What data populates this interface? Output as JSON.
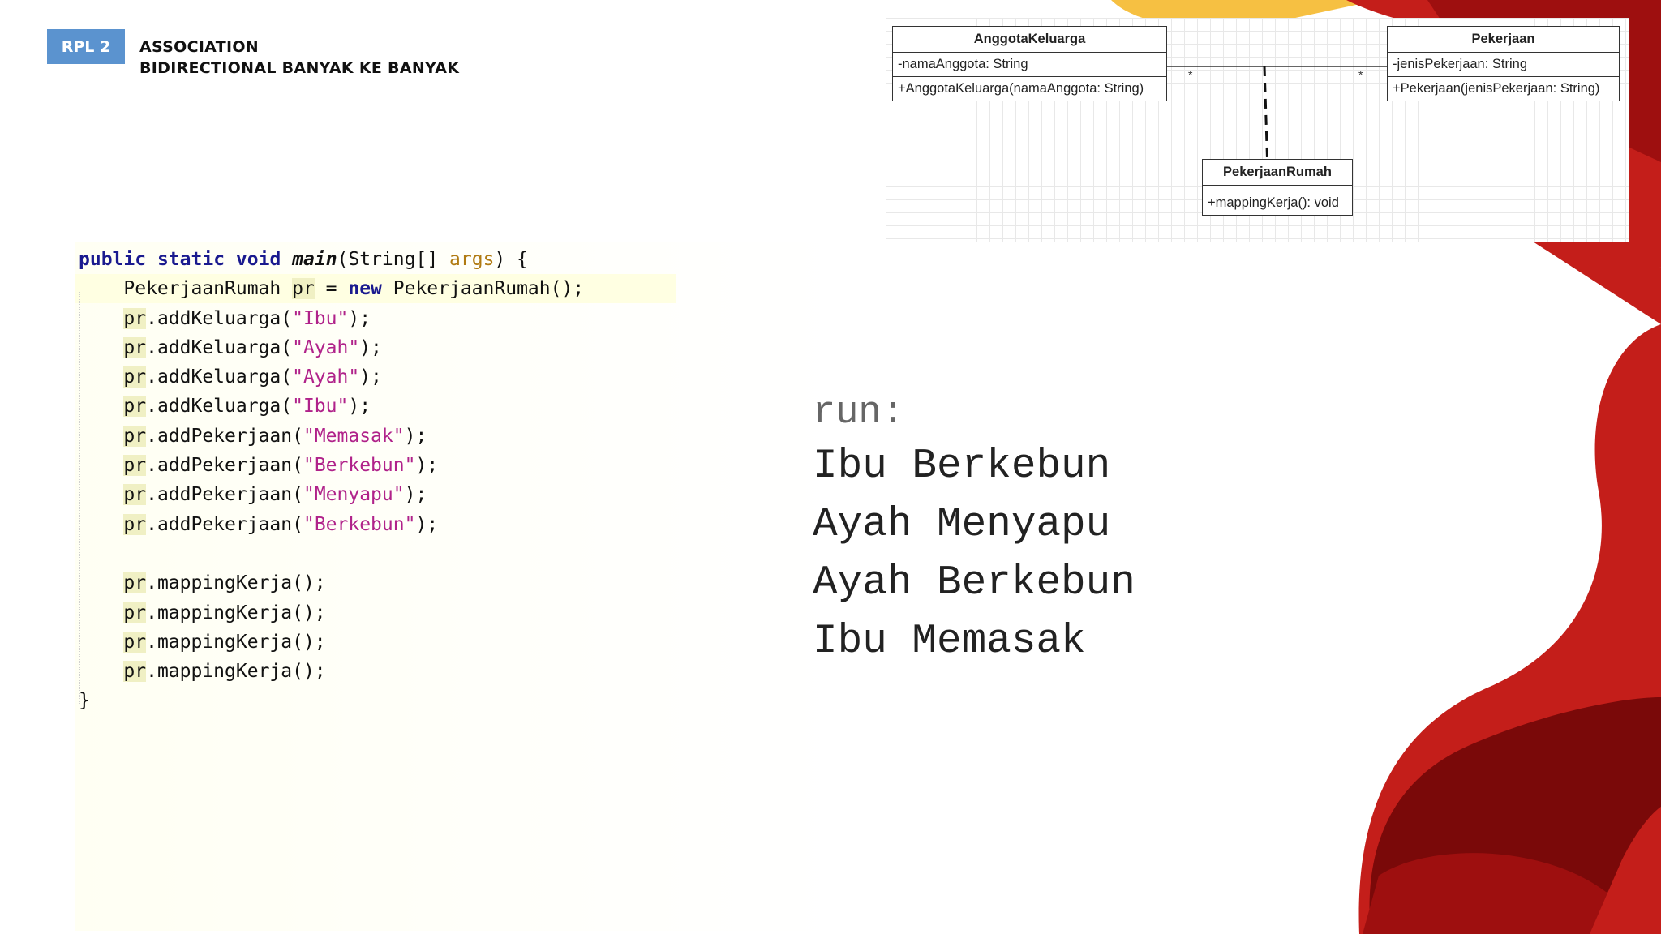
{
  "badge": {
    "label": "RPL 2"
  },
  "header": {
    "title_line1": "ASSOCIATION",
    "title_line2": "BIDIRECTIONAL BANYAK KE BANYAK"
  },
  "colors": {
    "badge": "#5b93cf",
    "deco_dark_red": "#9e0f0f",
    "deco_red": "#c41e1a",
    "deco_yellow": "#f6c042"
  },
  "uml": {
    "anggota": {
      "name": "AnggotaKeluarga",
      "attribute": "-namaAnggota: String",
      "operation": "+AnggotaKeluarga(namaAnggota: String)"
    },
    "pekerjaan": {
      "name": "Pekerjaan",
      "attribute": "-jenisPekerjaan: String",
      "operation": "+Pekerjaan(jenisPekerjaan: String)"
    },
    "pekerjaan_rumah": {
      "name": "PekerjaanRumah",
      "operation": "+mappingKerja(): void"
    },
    "multiplicity_left": "*",
    "multiplicity_right": "*"
  },
  "code": {
    "l1": {
      "kw1": "public",
      "kw2": "static",
      "kw3": "void",
      "method": "main",
      "params": "(String[] ",
      "arg": "args",
      "end": ") {"
    },
    "l2": {
      "type": "PekerjaanRumah ",
      "var": "pr",
      "eq": " = ",
      "kw": "new",
      "rest": " PekerjaanRumah();"
    },
    "var": "pr",
    "add_calls": [
      {
        "method": ".addKeluarga(",
        "arg": "\"Ibu\"",
        "end": ");"
      },
      {
        "method": ".addKeluarga(",
        "arg": "\"Ayah\"",
        "end": ");"
      },
      {
        "method": ".addKeluarga(",
        "arg": "\"Ayah\"",
        "end": ");"
      },
      {
        "method": ".addKeluarga(",
        "arg": "\"Ibu\"",
        "end": ");"
      },
      {
        "method": ".addPekerjaan(",
        "arg": "\"Memasak\"",
        "end": ");"
      },
      {
        "method": ".addPekerjaan(",
        "arg": "\"Berkebun\"",
        "end": ");"
      },
      {
        "method": ".addPekerjaan(",
        "arg": "\"Menyapu\"",
        "end": ");"
      },
      {
        "method": ".addPekerjaan(",
        "arg": "\"Berkebun\"",
        "end": ");"
      }
    ],
    "mapping_call": ".mappingKerja();",
    "closing": "}"
  },
  "output": {
    "run_label": "run:",
    "lines": [
      "Ibu Berkebun",
      "Ayah Menyapu",
      "Ayah Berkebun",
      "Ibu Memasak"
    ]
  }
}
